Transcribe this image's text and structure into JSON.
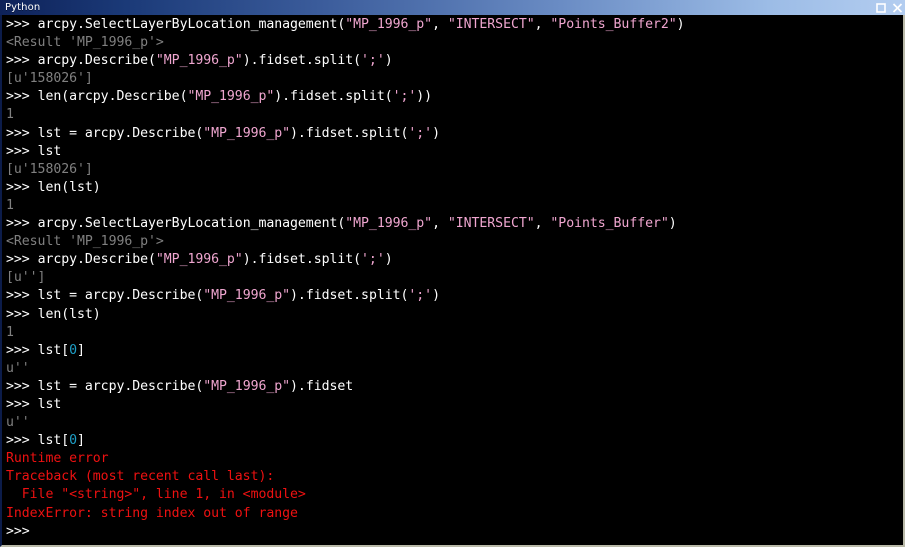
{
  "window": {
    "title": "Python",
    "controls": [
      {
        "name": "maximize-button",
        "label": "□"
      },
      {
        "name": "close-button",
        "label": "✕"
      }
    ]
  },
  "colors": {
    "titlebar_dark": "#0e2259",
    "titlebar_light": "#b3cdf0",
    "console_background": "#000000",
    "input_text": "#ffffff",
    "output_text": "#808080",
    "string_literal": "#f0a6d0",
    "number_literal": "#1ea0c8",
    "error_text": "#ee1111"
  },
  "console": {
    "prompt": ">>> ",
    "lines": [
      {
        "kind": "input",
        "segments": [
          {
            "t": ">>> ",
            "c": "prompt"
          },
          {
            "t": "arcpy.SelectLayerByLocation_management(",
            "c": "code"
          },
          {
            "t": "\"MP_1996_p\"",
            "c": "str"
          },
          {
            "t": ", ",
            "c": "code"
          },
          {
            "t": "\"INTERSECT\"",
            "c": "str"
          },
          {
            "t": ", ",
            "c": "code"
          },
          {
            "t": "\"Points_Buffer2\"",
            "c": "str"
          },
          {
            "t": ")",
            "c": "code"
          }
        ]
      },
      {
        "kind": "output",
        "segments": [
          {
            "t": "<Result 'MP_1996_p'>",
            "c": "out"
          }
        ]
      },
      {
        "kind": "input",
        "segments": [
          {
            "t": ">>> ",
            "c": "prompt"
          },
          {
            "t": "arcpy.Describe(",
            "c": "code"
          },
          {
            "t": "\"MP_1996_p\"",
            "c": "str"
          },
          {
            "t": ").fidset.split(",
            "c": "code"
          },
          {
            "t": "';'",
            "c": "str"
          },
          {
            "t": ")",
            "c": "code"
          }
        ]
      },
      {
        "kind": "output",
        "segments": [
          {
            "t": "[u'158026']",
            "c": "out"
          }
        ]
      },
      {
        "kind": "input",
        "segments": [
          {
            "t": ">>> ",
            "c": "prompt"
          },
          {
            "t": "len(arcpy.Describe(",
            "c": "code"
          },
          {
            "t": "\"MP_1996_p\"",
            "c": "str"
          },
          {
            "t": ").fidset.split(",
            "c": "code"
          },
          {
            "t": "';'",
            "c": "str"
          },
          {
            "t": "))",
            "c": "code"
          }
        ]
      },
      {
        "kind": "output",
        "segments": [
          {
            "t": "1",
            "c": "out"
          }
        ]
      },
      {
        "kind": "input",
        "segments": [
          {
            "t": ">>> ",
            "c": "prompt"
          },
          {
            "t": "lst = arcpy.Describe(",
            "c": "code"
          },
          {
            "t": "\"MP_1996_p\"",
            "c": "str"
          },
          {
            "t": ").fidset.split(",
            "c": "code"
          },
          {
            "t": "';'",
            "c": "str"
          },
          {
            "t": ")",
            "c": "code"
          }
        ]
      },
      {
        "kind": "input",
        "segments": [
          {
            "t": ">>> ",
            "c": "prompt"
          },
          {
            "t": "lst",
            "c": "code"
          }
        ]
      },
      {
        "kind": "output",
        "segments": [
          {
            "t": "[u'158026']",
            "c": "out"
          }
        ]
      },
      {
        "kind": "input",
        "segments": [
          {
            "t": ">>> ",
            "c": "prompt"
          },
          {
            "t": "len(lst)",
            "c": "code"
          }
        ]
      },
      {
        "kind": "output",
        "segments": [
          {
            "t": "1",
            "c": "out"
          }
        ]
      },
      {
        "kind": "input",
        "segments": [
          {
            "t": ">>> ",
            "c": "prompt"
          },
          {
            "t": "arcpy.SelectLayerByLocation_management(",
            "c": "code"
          },
          {
            "t": "\"MP_1996_p\"",
            "c": "str"
          },
          {
            "t": ", ",
            "c": "code"
          },
          {
            "t": "\"INTERSECT\"",
            "c": "str"
          },
          {
            "t": ", ",
            "c": "code"
          },
          {
            "t": "\"Points_Buffer\"",
            "c": "str"
          },
          {
            "t": ")",
            "c": "code"
          }
        ]
      },
      {
        "kind": "output",
        "segments": [
          {
            "t": "<Result 'MP_1996_p'>",
            "c": "out"
          }
        ]
      },
      {
        "kind": "input",
        "segments": [
          {
            "t": ">>> ",
            "c": "prompt"
          },
          {
            "t": "arcpy.Describe(",
            "c": "code"
          },
          {
            "t": "\"MP_1996_p\"",
            "c": "str"
          },
          {
            "t": ").fidset.split(",
            "c": "code"
          },
          {
            "t": "';'",
            "c": "str"
          },
          {
            "t": ")",
            "c": "code"
          }
        ]
      },
      {
        "kind": "output",
        "segments": [
          {
            "t": "[u'']",
            "c": "out"
          }
        ]
      },
      {
        "kind": "input",
        "segments": [
          {
            "t": ">>> ",
            "c": "prompt"
          },
          {
            "t": "lst = arcpy.Describe(",
            "c": "code"
          },
          {
            "t": "\"MP_1996_p\"",
            "c": "str"
          },
          {
            "t": ").fidset.split(",
            "c": "code"
          },
          {
            "t": "';'",
            "c": "str"
          },
          {
            "t": ")",
            "c": "code"
          }
        ]
      },
      {
        "kind": "input",
        "segments": [
          {
            "t": ">>> ",
            "c": "prompt"
          },
          {
            "t": "len(lst)",
            "c": "code"
          }
        ]
      },
      {
        "kind": "output",
        "segments": [
          {
            "t": "1",
            "c": "out"
          }
        ]
      },
      {
        "kind": "input",
        "segments": [
          {
            "t": ">>> ",
            "c": "prompt"
          },
          {
            "t": "lst[",
            "c": "code"
          },
          {
            "t": "0",
            "c": "num"
          },
          {
            "t": "]",
            "c": "code"
          }
        ]
      },
      {
        "kind": "output",
        "segments": [
          {
            "t": "u''",
            "c": "out"
          }
        ]
      },
      {
        "kind": "input",
        "segments": [
          {
            "t": ">>> ",
            "c": "prompt"
          },
          {
            "t": "lst = arcpy.Describe(",
            "c": "code"
          },
          {
            "t": "\"MP_1996_p\"",
            "c": "str"
          },
          {
            "t": ").fidset",
            "c": "code"
          }
        ]
      },
      {
        "kind": "input",
        "segments": [
          {
            "t": ">>> ",
            "c": "prompt"
          },
          {
            "t": "lst",
            "c": "code"
          }
        ]
      },
      {
        "kind": "output",
        "segments": [
          {
            "t": "u''",
            "c": "out"
          }
        ]
      },
      {
        "kind": "input",
        "segments": [
          {
            "t": ">>> ",
            "c": "prompt"
          },
          {
            "t": "lst[",
            "c": "code"
          },
          {
            "t": "0",
            "c": "num"
          },
          {
            "t": "]",
            "c": "code"
          }
        ]
      },
      {
        "kind": "error",
        "segments": [
          {
            "t": "Runtime error",
            "c": "err"
          }
        ]
      },
      {
        "kind": "error",
        "segments": [
          {
            "t": "Traceback (most recent call last):",
            "c": "err"
          }
        ]
      },
      {
        "kind": "error",
        "segments": [
          {
            "t": "  File \"<string>\", line 1, in <module>",
            "c": "err"
          }
        ]
      },
      {
        "kind": "error",
        "segments": [
          {
            "t": "IndexError: string index out of range",
            "c": "err"
          }
        ]
      },
      {
        "kind": "input",
        "segments": [
          {
            "t": ">>> ",
            "c": "prompt"
          }
        ]
      }
    ]
  }
}
